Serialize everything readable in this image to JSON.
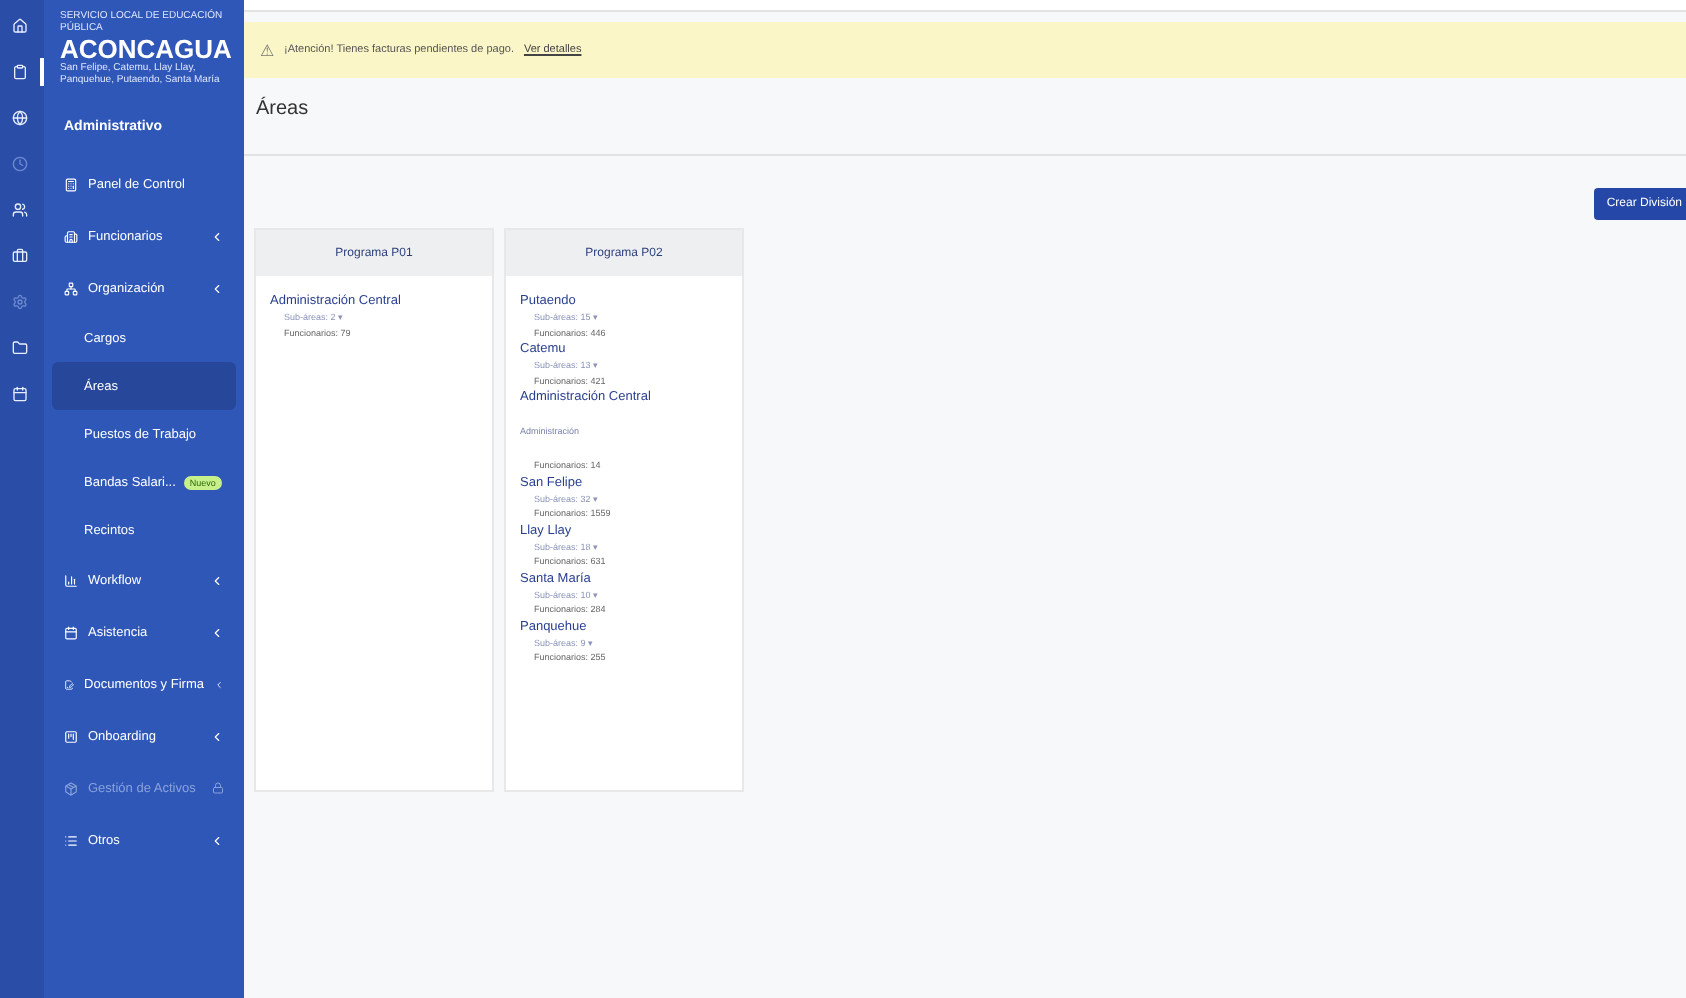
{
  "rail": [
    {
      "selected": false,
      "disabled": false
    },
    {
      "selected": true,
      "disabled": false
    },
    {
      "selected": false,
      "disabled": false
    },
    {
      "selected": false,
      "disabled": true
    },
    {
      "selected": false,
      "disabled": false
    },
    {
      "selected": false,
      "disabled": false
    },
    {
      "selected": false,
      "disabled": true
    },
    {
      "selected": false,
      "disabled": false
    },
    {
      "selected": false,
      "disabled": false
    }
  ],
  "logo": {
    "top": "SERVICIO LOCAL DE EDUCACIÓN PÚBLICA",
    "name": "ACONCAGUA",
    "bottom": "San Felipe, Catemu, Llay Llay, Panquehue, Putaendo, Santa María"
  },
  "sidebar": {
    "section": "Administrativo",
    "items": [
      {
        "kind": "item",
        "label": "Panel de Control",
        "expandable": false,
        "disabled": false
      },
      {
        "kind": "item",
        "label": "Funcionarios",
        "expandable": true,
        "disabled": false
      },
      {
        "kind": "item",
        "label": "Organización",
        "expandable": true,
        "disabled": false,
        "children": [
          {
            "label": "Cargos",
            "selected": false
          },
          {
            "label": "Áreas",
            "selected": true
          },
          {
            "label": "Puestos de Trabajo",
            "selected": false
          },
          {
            "label": "Bandas Salari...",
            "badge": "Nuevo",
            "selected": false
          },
          {
            "label": "Recintos",
            "selected": false
          }
        ]
      },
      {
        "kind": "item",
        "label": "Workflow",
        "expandable": true,
        "disabled": false
      },
      {
        "kind": "item",
        "label": "Asistencia",
        "expandable": true,
        "disabled": false
      },
      {
        "kind": "item",
        "label": "Documentos y Firma",
        "expandable": true,
        "disabled": false
      },
      {
        "kind": "item",
        "label": "Onboarding",
        "expandable": true,
        "disabled": false
      },
      {
        "kind": "item",
        "label": "Gestión de Activos",
        "locked": true,
        "expandable": false,
        "disabled": true
      },
      {
        "kind": "item",
        "label": "Otros",
        "expandable": true,
        "disabled": false
      }
    ]
  },
  "alert": {
    "icon": "⚠",
    "text": "¡Atención! Tienes facturas pendientes de pago.",
    "link": "Ver detalles"
  },
  "page_title": "Áreas",
  "create_button": "Crear División",
  "programs": [
    {
      "title": "Programa P01",
      "areas": [
        {
          "kind": "area",
          "name": "Administración Central",
          "sub_areas": "Sub-áreas: 2 ▾",
          "funcionarios": "Funcionarios: 79"
        }
      ]
    },
    {
      "title": "Programa P02",
      "areas": [
        {
          "kind": "area",
          "name": "Putaendo",
          "sub_areas": "Sub-áreas: 15 ▾",
          "funcionarios": "Funcionarios: 446"
        },
        {
          "kind": "area",
          "name": "Catemu",
          "sub_areas": "Sub-áreas: 13 ▾",
          "funcionarios": "Funcionarios: 421"
        },
        {
          "kind": "area",
          "name": "Administración Central",
          "note": "Administración",
          "funcionarios": "Funcionarios: 14"
        },
        {
          "kind": "area",
          "name": "San Felipe",
          "sub_areas": "Sub-áreas: 32 ▾",
          "funcionarios": "Funcionarios: 1559"
        },
        {
          "kind": "area",
          "name": "Llay Llay",
          "sub_areas": "Sub-áreas: 18 ▾",
          "funcionarios": "Funcionarios: 631"
        },
        {
          "kind": "area",
          "name": "Santa María",
          "sub_areas": "Sub-áreas: 10 ▾",
          "funcionarios": "Funcionarios: 284"
        },
        {
          "kind": "area",
          "name": "Panquehue",
          "sub_areas": "Sub-áreas: 9 ▾",
          "funcionarios": "Funcionarios: 255"
        }
      ]
    }
  ]
}
